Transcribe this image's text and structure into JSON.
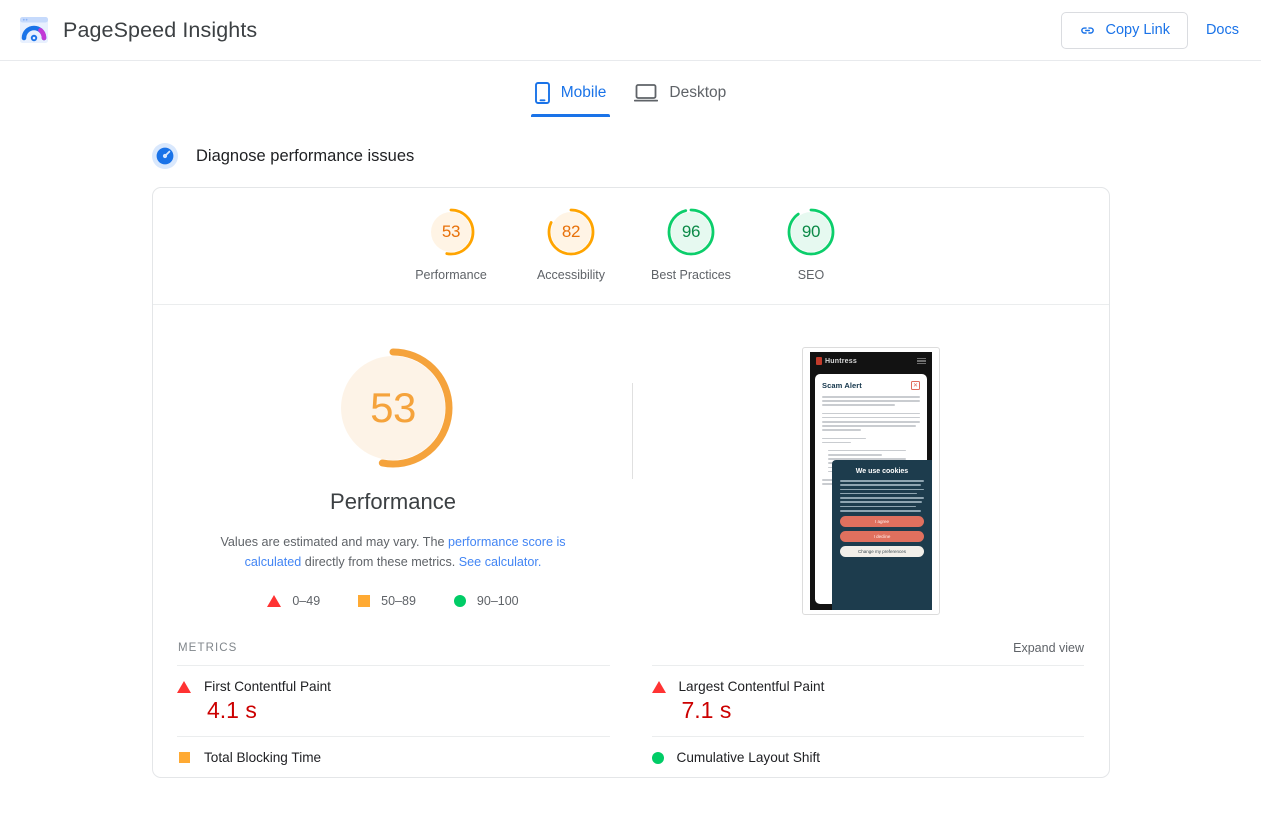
{
  "header": {
    "logo_icon": "pagespeed-logo-icon",
    "title": "PageSpeed Insights",
    "copy_link_label": "Copy Link",
    "copy_link_icon": "link-icon",
    "docs_label": "Docs"
  },
  "tabs": [
    {
      "label": "Mobile",
      "icon": "mobile-phone-icon",
      "active": true
    },
    {
      "label": "Desktop",
      "icon": "desktop-monitor-icon",
      "active": false
    }
  ],
  "section": {
    "icon": "speedometer-icon",
    "title": "Diagnose performance issues"
  },
  "category_scores": [
    {
      "label": "Performance",
      "value": "53",
      "percent": 53,
      "color": "#ffa400",
      "track": "#fff4e5",
      "text_color": "#e8710a"
    },
    {
      "label": "Accessibility",
      "value": "82",
      "percent": 82,
      "color": "#ffa400",
      "track": "#fff4e5",
      "text_color": "#e8710a"
    },
    {
      "label": "Best Practices",
      "value": "96",
      "percent": 96,
      "color": "#0cce6b",
      "track": "#e6f9f0",
      "text_color": "#0b8a47"
    },
    {
      "label": "SEO",
      "value": "90",
      "percent": 90,
      "color": "#0cce6b",
      "track": "#e6f9f0",
      "text_color": "#0b8a47"
    }
  ],
  "main_score": {
    "value": "53",
    "percent": 53,
    "label": "Performance",
    "color": "#f5a33c",
    "track": "#fdf3e7",
    "description_part1": "Values are estimated and may vary. The ",
    "description_link1": "performance score is calculated",
    "description_part2": " directly from these metrics. ",
    "description_link2": "See calculator."
  },
  "legend": [
    {
      "shape": "triangle",
      "label": "0–49",
      "color": "#ff3333"
    },
    {
      "shape": "square",
      "label": "50–89",
      "color": "#ffaa33"
    },
    {
      "shape": "circle",
      "label": "90–100",
      "color": "#00cc66"
    }
  ],
  "screenshot": {
    "site_name": "Huntress",
    "modal_title": "Scam Alert",
    "close_icon": "close-icon",
    "menu_icon": "hamburger-menu-icon",
    "cookie_title": "We use cookies",
    "cookie_buttons": [
      {
        "label": "I agree"
      },
      {
        "label": "I decline"
      },
      {
        "label": "Change my preferences"
      }
    ]
  },
  "metrics_section": {
    "title": "METRICS",
    "expand_label": "Expand view"
  },
  "metrics": [
    {
      "name": "First Contentful Paint",
      "value": "4.1 s",
      "shape": "triangle",
      "color": "#ff3333",
      "value_color": "#cc0000"
    },
    {
      "name": "Largest Contentful Paint",
      "value": "7.1 s",
      "shape": "triangle",
      "color": "#ff3333",
      "value_color": "#cc0000"
    },
    {
      "name": "Total Blocking Time",
      "value": "",
      "shape": "square",
      "color": "#ffaa33",
      "value_color": "#e8710a"
    },
    {
      "name": "Cumulative Layout Shift",
      "value": "",
      "shape": "circle",
      "color": "#00cc66",
      "value_color": "#0b8a47"
    }
  ]
}
